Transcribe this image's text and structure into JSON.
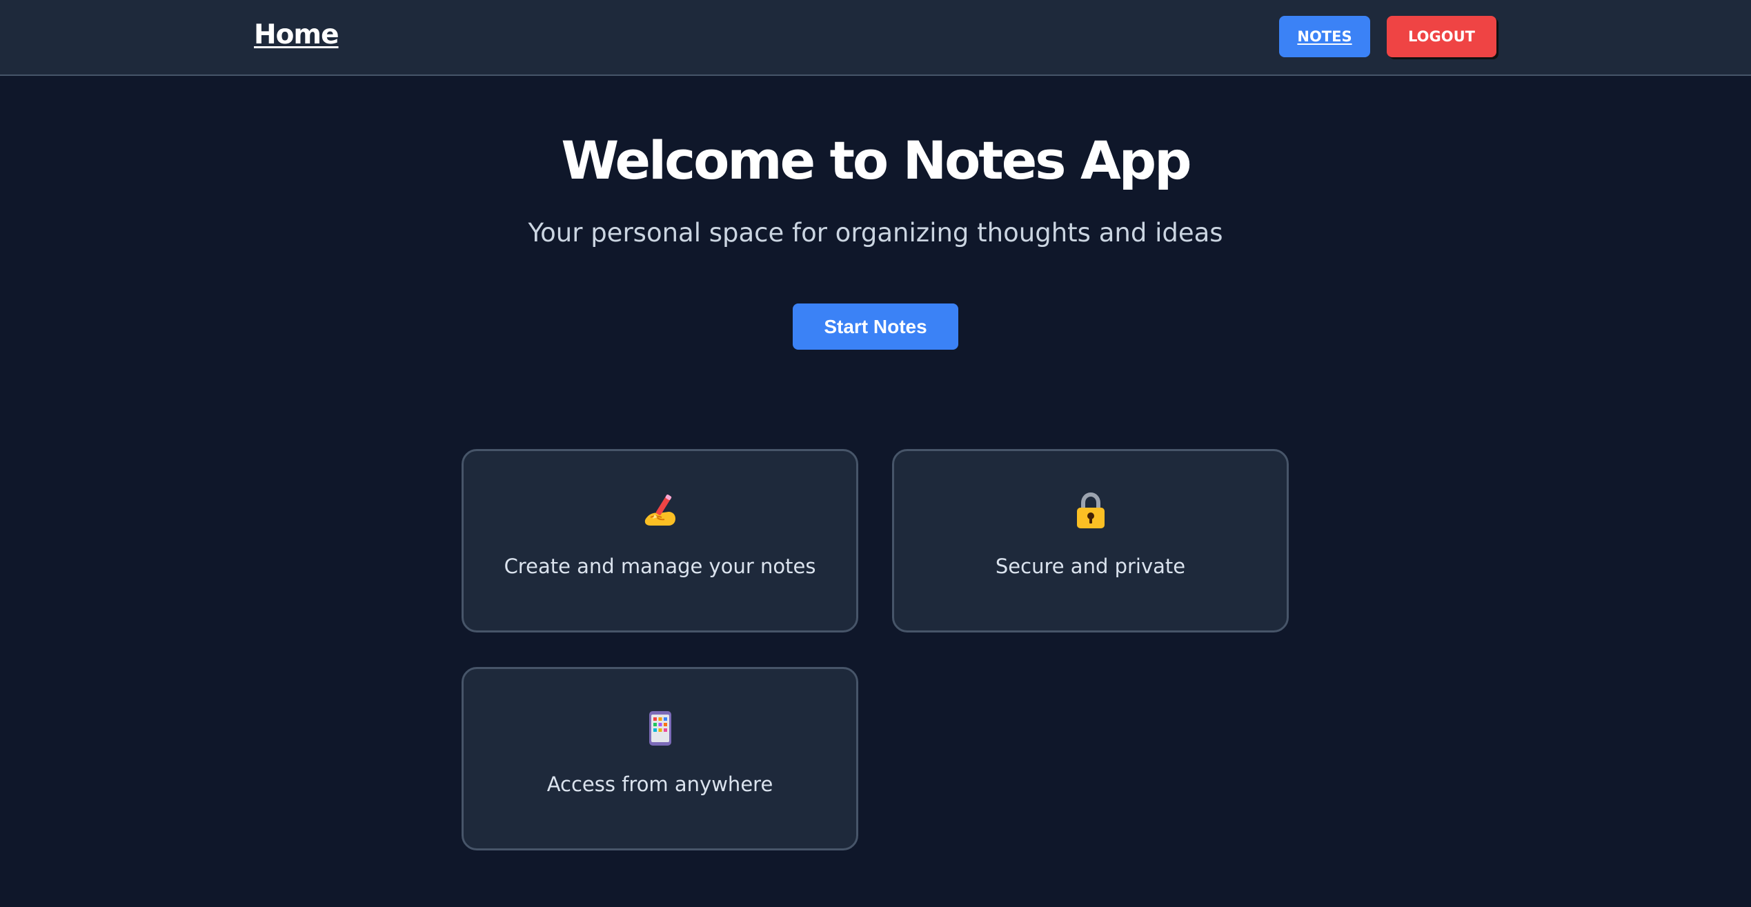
{
  "navbar": {
    "brand": "Home",
    "notes_label": "NOTES",
    "logout_label": "LOGOUT"
  },
  "hero": {
    "title": "Welcome to Notes App",
    "subtitle": "Your personal space for organizing thoughts and ideas",
    "cta_label": "Start Notes"
  },
  "features": [
    {
      "icon": "writing-hand-icon",
      "text": "Create and manage your notes"
    },
    {
      "icon": "lock-icon",
      "text": "Secure and private"
    },
    {
      "icon": "mobile-phone-icon",
      "text": "Access from anywhere"
    }
  ],
  "colors": {
    "background": "#0f172a",
    "navbar": "#1e293b",
    "primary": "#3b82f6",
    "danger": "#ef4444",
    "card_border": "#475569"
  }
}
